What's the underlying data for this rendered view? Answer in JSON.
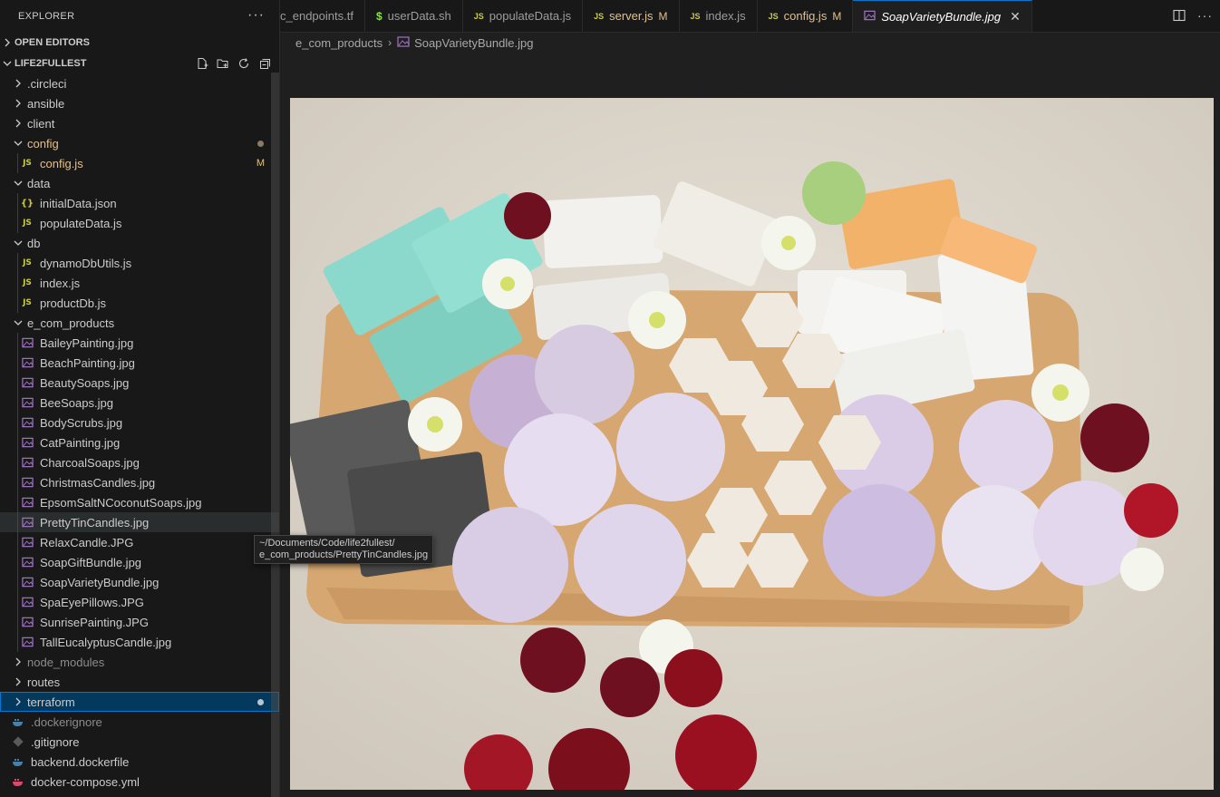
{
  "explorer": {
    "title": "EXPLORER",
    "more": "···",
    "open_editors": "OPEN EDITORS",
    "project": "LIFE2FULLEST"
  },
  "tree": [
    {
      "label": ".circleci",
      "kind": "folder",
      "depth": 0,
      "expanded": false
    },
    {
      "label": "ansible",
      "kind": "folder",
      "depth": 0,
      "expanded": false
    },
    {
      "label": "client",
      "kind": "folder",
      "depth": 0,
      "expanded": false
    },
    {
      "label": "config",
      "kind": "folder",
      "depth": 0,
      "expanded": true,
      "status": "dot",
      "modified": true
    },
    {
      "label": "config.js",
      "kind": "js",
      "depth": 1,
      "badge": "M",
      "modified": true
    },
    {
      "label": "data",
      "kind": "folder",
      "depth": 0,
      "expanded": true
    },
    {
      "label": "initialData.json",
      "kind": "json",
      "depth": 1
    },
    {
      "label": "populateData.js",
      "kind": "js",
      "depth": 1
    },
    {
      "label": "db",
      "kind": "folder",
      "depth": 0,
      "expanded": true
    },
    {
      "label": "dynamoDbUtils.js",
      "kind": "js",
      "depth": 1
    },
    {
      "label": "index.js",
      "kind": "js",
      "depth": 1
    },
    {
      "label": "productDb.js",
      "kind": "js",
      "depth": 1
    },
    {
      "label": "e_com_products",
      "kind": "folder",
      "depth": 0,
      "expanded": true
    },
    {
      "label": "BaileyPainting.jpg",
      "kind": "img",
      "depth": 1
    },
    {
      "label": "BeachPainting.jpg",
      "kind": "img",
      "depth": 1
    },
    {
      "label": "BeautySoaps.jpg",
      "kind": "img",
      "depth": 1
    },
    {
      "label": "BeeSoaps.jpg",
      "kind": "img",
      "depth": 1
    },
    {
      "label": "BodyScrubs.jpg",
      "kind": "img",
      "depth": 1
    },
    {
      "label": "CatPainting.jpg",
      "kind": "img",
      "depth": 1
    },
    {
      "label": "CharcoalSoaps.jpg",
      "kind": "img",
      "depth": 1
    },
    {
      "label": "ChristmasCandles.jpg",
      "kind": "img",
      "depth": 1
    },
    {
      "label": "EpsomSaltNCoconutSoaps.jpg",
      "kind": "img",
      "depth": 1
    },
    {
      "label": "PrettyTinCandles.jpg",
      "kind": "img",
      "depth": 1,
      "hover": true
    },
    {
      "label": "RelaxCandle.JPG",
      "kind": "img",
      "depth": 1
    },
    {
      "label": "SoapGiftBundle.jpg",
      "kind": "img",
      "depth": 1
    },
    {
      "label": "SoapVarietyBundle.jpg",
      "kind": "img",
      "depth": 1
    },
    {
      "label": "SpaEyePillows.JPG",
      "kind": "img",
      "depth": 1
    },
    {
      "label": "SunrisePainting.JPG",
      "kind": "img",
      "depth": 1
    },
    {
      "label": "TallEucalyptusCandle.jpg",
      "kind": "img",
      "depth": 1
    },
    {
      "label": "node_modules",
      "kind": "folder",
      "depth": 0,
      "expanded": false,
      "dim": true
    },
    {
      "label": "routes",
      "kind": "folder",
      "depth": 0,
      "expanded": false
    },
    {
      "label": "terraform",
      "kind": "folder",
      "depth": 0,
      "expanded": false,
      "selected": true,
      "status": "dot"
    },
    {
      "label": ".dockerignore",
      "kind": "docker",
      "depth": 0,
      "dim": true
    },
    {
      "label": ".gitignore",
      "kind": "git",
      "depth": 0
    },
    {
      "label": "backend.dockerfile",
      "kind": "docker",
      "depth": 0
    },
    {
      "label": "docker-compose.yml",
      "kind": "compose",
      "depth": 0
    }
  ],
  "tabs": [
    {
      "label": "c_endpoints.tf",
      "icon": "tf"
    },
    {
      "label": "userData.sh",
      "icon": "sh"
    },
    {
      "label": "populateData.js",
      "icon": "js"
    },
    {
      "label": "server.js",
      "icon": "js",
      "badge": "M"
    },
    {
      "label": "index.js",
      "icon": "js"
    },
    {
      "label": "config.js",
      "icon": "js",
      "badge": "M"
    },
    {
      "label": "SoapVarietyBundle.jpg",
      "icon": "img",
      "active": true
    }
  ],
  "breadcrumb": {
    "folder": "e_com_products",
    "file": "SoapVarietyBundle.jpg"
  },
  "tooltip": {
    "line1": "~/Documents/Code/life2fullest/",
    "line2": "e_com_products/PrettyTinCandles.jpg"
  },
  "colors": {
    "accent": "#0078d4",
    "modified": "#e2c08d",
    "js": "#cbcb41",
    "image": "#a074c4"
  }
}
